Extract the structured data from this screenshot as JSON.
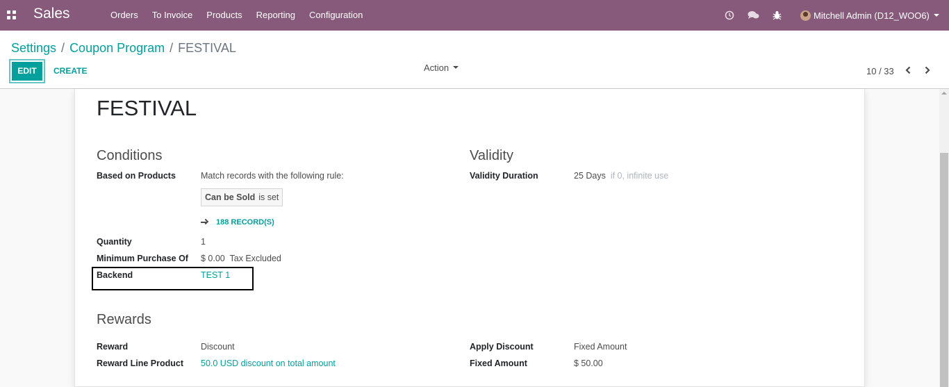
{
  "navbar": {
    "brand": "Sales",
    "menu": [
      "Orders",
      "To Invoice",
      "Products",
      "Reporting",
      "Configuration"
    ],
    "user": "Mitchell Admin (D12_WOO6)"
  },
  "breadcrumb": {
    "items": [
      "Settings",
      "Coupon Program"
    ],
    "current": "FESTIVAL"
  },
  "buttons": {
    "edit": "EDIT",
    "create": "CREATE",
    "action": "Action"
  },
  "pager": {
    "value": "10 / 33"
  },
  "form": {
    "title": "FESTIVAL",
    "conditions": {
      "heading": "Conditions",
      "based_on_products_label": "Based on Products",
      "based_on_products_value": "Match records with the following rule:",
      "domain_field": "Can be Sold",
      "domain_op": "is set",
      "records": "188 RECORD(S)",
      "quantity_label": "Quantity",
      "quantity_value": "1",
      "min_purchase_label": "Minimum Purchase Of",
      "min_purchase_value": "$ 0.00",
      "min_purchase_tax": "Tax Excluded",
      "backend_label": "Backend",
      "backend_value": "TEST 1"
    },
    "validity": {
      "heading": "Validity",
      "duration_label": "Validity Duration",
      "duration_value": "25 Days",
      "duration_hint": "if 0, infinite use"
    },
    "rewards": {
      "heading": "Rewards",
      "reward_label": "Reward",
      "reward_value": "Discount",
      "reward_line_label": "Reward Line Product",
      "reward_line_value": "50.0 USD discount on total amount",
      "apply_discount_label": "Apply Discount",
      "apply_discount_value": "Fixed Amount",
      "fixed_amount_label": "Fixed Amount",
      "fixed_amount_value": "$ 50.00"
    }
  },
  "colors": {
    "navbar": "#875a7b",
    "accent": "#00a09d"
  }
}
